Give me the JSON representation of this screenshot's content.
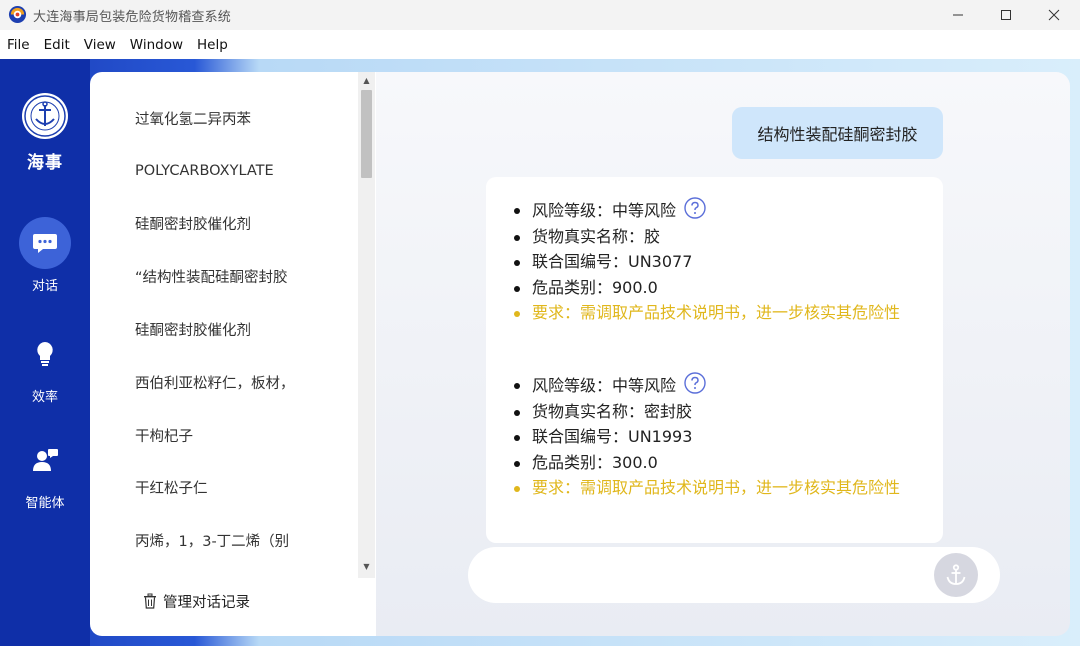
{
  "window": {
    "title": "大连海事局包装危险货物稽查系统",
    "minimize_icon": "minimize-icon",
    "maximize_icon": "maximize-icon",
    "close_icon": "close-icon"
  },
  "menu": [
    "File",
    "Edit",
    "View",
    "Window",
    "Help"
  ],
  "rail": {
    "brand": "海事",
    "logo_icon": "china-msa-emblem",
    "items": [
      {
        "label": "对话",
        "icon": "chat-bubble-icon",
        "active": true
      },
      {
        "label": "效率",
        "icon": "lightbulb-icon",
        "active": false
      },
      {
        "label": "智能体",
        "icon": "agent-user-icon",
        "active": false
      }
    ]
  },
  "history": {
    "items": [
      "过氧化氢二异丙苯",
      "POLYCARBOXYLATE",
      "硅酮密封胶催化剂",
      "“结构性装配硅酮密封胶",
      "硅酮密封胶催化剂",
      "西伯利亚松籽仁，板材，",
      "干枸杞子",
      "干红松子仁",
      "丙烯，1，3-丁二烯（别"
    ],
    "manage_label": "管理对话记录",
    "manage_icon": "trash-icon"
  },
  "chat": {
    "user_message": "结构性装配硅酮密封胶",
    "results": [
      {
        "risk": "风险等级：中等风险",
        "name": "货物真实名称：胶",
        "un": "联合国编号：UN3077",
        "class": "危品类别：900.0",
        "requirement": "要求：需调取产品技术说明书，进一步核实其危险性"
      },
      {
        "risk": "风险等级：中等风险",
        "name": "货物真实名称：密封胶",
        "un": "联合国编号：UN1993",
        "class": "危品类别：300.0",
        "requirement": "要求：需调取产品技术说明书，进一步核实其危险性"
      }
    ],
    "help_icon": "question-circle-icon",
    "input_value": "",
    "send_icon": "anchor-icon"
  },
  "colors": {
    "rail": "#0f2fa8",
    "active_item": "#3d63d8",
    "user_bubble": "#cfe6fb",
    "requirement_text": "#e0b71c",
    "help_icon": "#5b6fd9"
  }
}
